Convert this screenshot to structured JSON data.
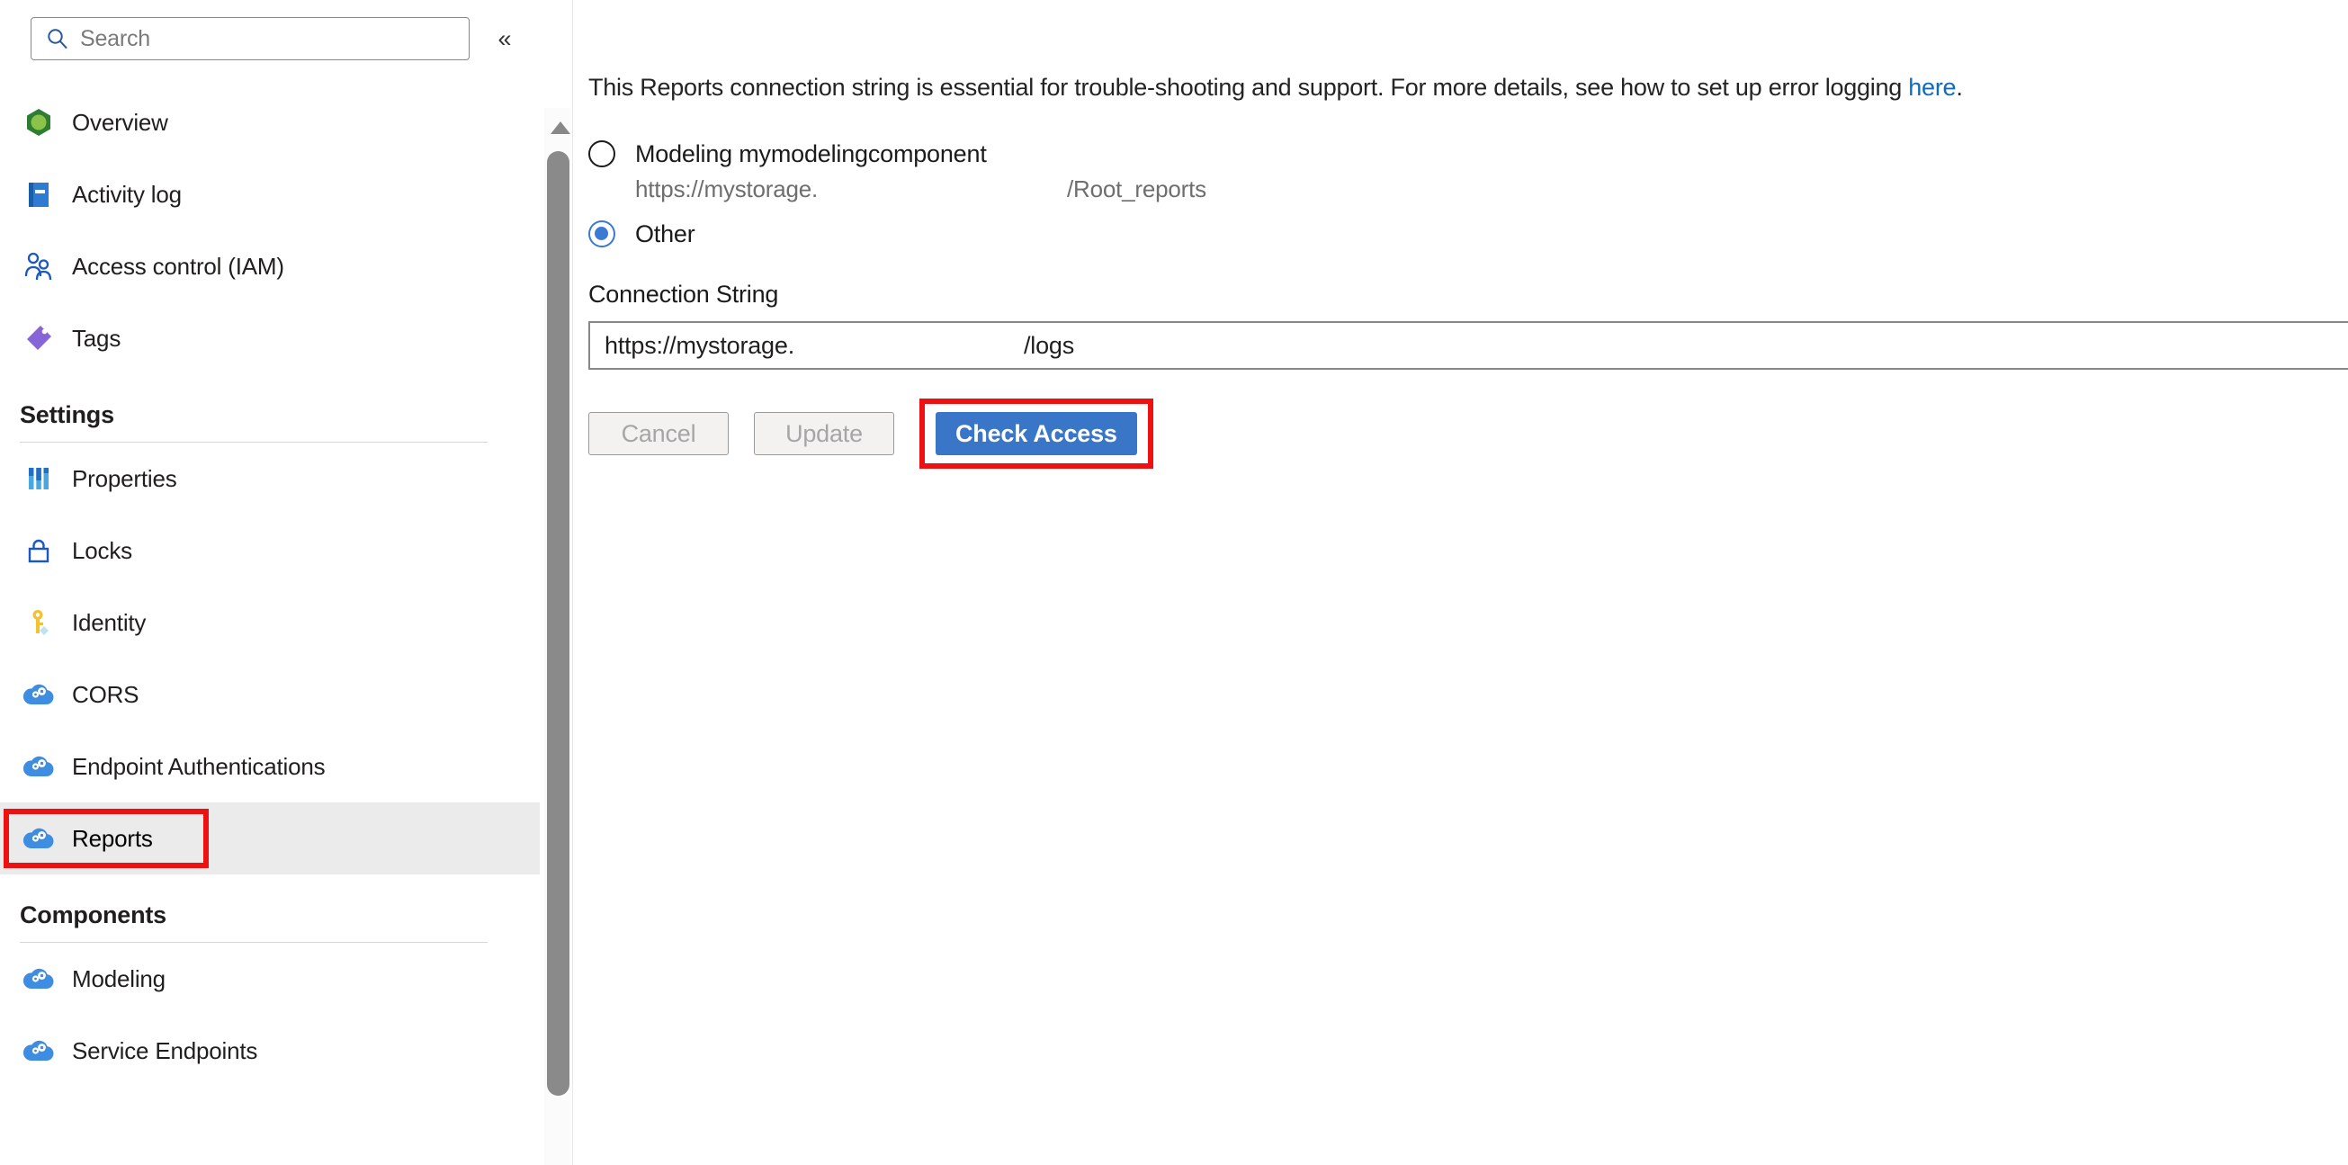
{
  "sidebar": {
    "search": {
      "placeholder": "Search",
      "icon": "search-icon"
    },
    "collapse_icon": "«",
    "items": [
      {
        "label": "Overview",
        "icon": "overview-hexagon-icon",
        "selected": false
      },
      {
        "label": "Activity log",
        "icon": "activity-log-book-icon",
        "selected": false
      },
      {
        "label": "Access control (IAM)",
        "icon": "access-control-people-icon",
        "selected": false
      },
      {
        "label": "Tags",
        "icon": "tags-icon",
        "selected": false
      }
    ],
    "sections": [
      {
        "title": "Settings",
        "items": [
          {
            "label": "Properties",
            "icon": "properties-bars-icon",
            "selected": false
          },
          {
            "label": "Locks",
            "icon": "lock-icon",
            "selected": false
          },
          {
            "label": "Identity",
            "icon": "identity-key-icon",
            "selected": false
          },
          {
            "label": "CORS",
            "icon": "cloud-gear-icon",
            "selected": false
          },
          {
            "label": "Endpoint Authentications",
            "icon": "cloud-gear-icon",
            "selected": false
          },
          {
            "label": "Reports",
            "icon": "cloud-gear-icon",
            "selected": true,
            "highlighted": true
          }
        ]
      },
      {
        "title": "Components",
        "items": [
          {
            "label": "Modeling",
            "icon": "cloud-gear-icon",
            "selected": false
          },
          {
            "label": "Service Endpoints",
            "icon": "cloud-gear-icon",
            "selected": false
          }
        ]
      }
    ]
  },
  "main": {
    "description": {
      "before_link": "This Reports connection string is essential for trouble-shooting and support. For more details, see how to set up error logging ",
      "link_text": "here",
      "after_link": "."
    },
    "radios": [
      {
        "label": "Modeling mymodelingcomponent",
        "selected": false,
        "sub_prefix": "https://mystorage.",
        "sub_suffix": "/Root_reports"
      },
      {
        "label": "Other",
        "selected": true
      }
    ],
    "connection_string": {
      "label": "Connection String",
      "value_prefix": "https://mystorage.",
      "value_suffix": "/logs"
    },
    "buttons": {
      "cancel": "Cancel",
      "update": "Update",
      "check_access": "Check Access"
    }
  },
  "colors": {
    "primary_button": "#3a76c8",
    "link": "#0f6cbd",
    "highlight_outline": "#ee1111",
    "selected_row": "#ebebeb",
    "radio_selected": "#3a79d4"
  }
}
